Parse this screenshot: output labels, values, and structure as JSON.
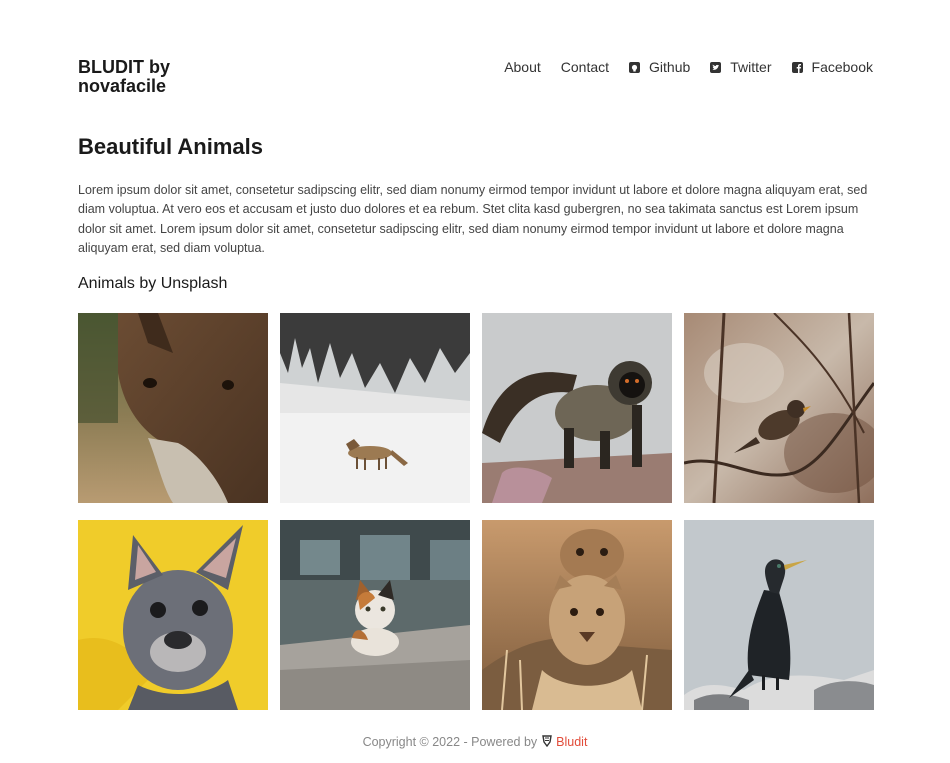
{
  "site": {
    "title": "BLUDIT by novafacile"
  },
  "nav": {
    "items": [
      {
        "label": "About"
      },
      {
        "label": "Contact"
      },
      {
        "label": "Github",
        "icon": "github-icon"
      },
      {
        "label": "Twitter",
        "icon": "twitter-icon"
      },
      {
        "label": "Facebook",
        "icon": "facebook-icon"
      }
    ]
  },
  "page": {
    "title": "Beautiful Animals",
    "intro": "Lorem ipsum dolor sit amet, consetetur sadipscing elitr, sed diam nonumy eirmod tempor invidunt ut labore et dolore magna aliquyam erat, sed diam voluptua. At vero eos et accusam et justo duo dolores et ea rebum. Stet clita kasd gubergren, no sea takimata sanctus est Lorem ipsum dolor sit amet. Lorem ipsum dolor sit amet, consetetur sadipscing elitr, sed diam nonumy eirmod tempor invidunt ut labore et dolore magna aliquyam erat, sed diam voluptua.",
    "gallery_title": "Animals by Unsplash"
  },
  "gallery": {
    "images": [
      {
        "subject": "donkey"
      },
      {
        "subject": "coyote in snow"
      },
      {
        "subject": "monkey"
      },
      {
        "subject": "bird on branch"
      },
      {
        "subject": "french bulldog"
      },
      {
        "subject": "cat"
      },
      {
        "subject": "lions"
      },
      {
        "subject": "cormorant"
      }
    ]
  },
  "footer": {
    "copyright": "Copyright © 2022 - Powered by",
    "link_label": "Bludit",
    "link_color": "#e24d3b"
  }
}
